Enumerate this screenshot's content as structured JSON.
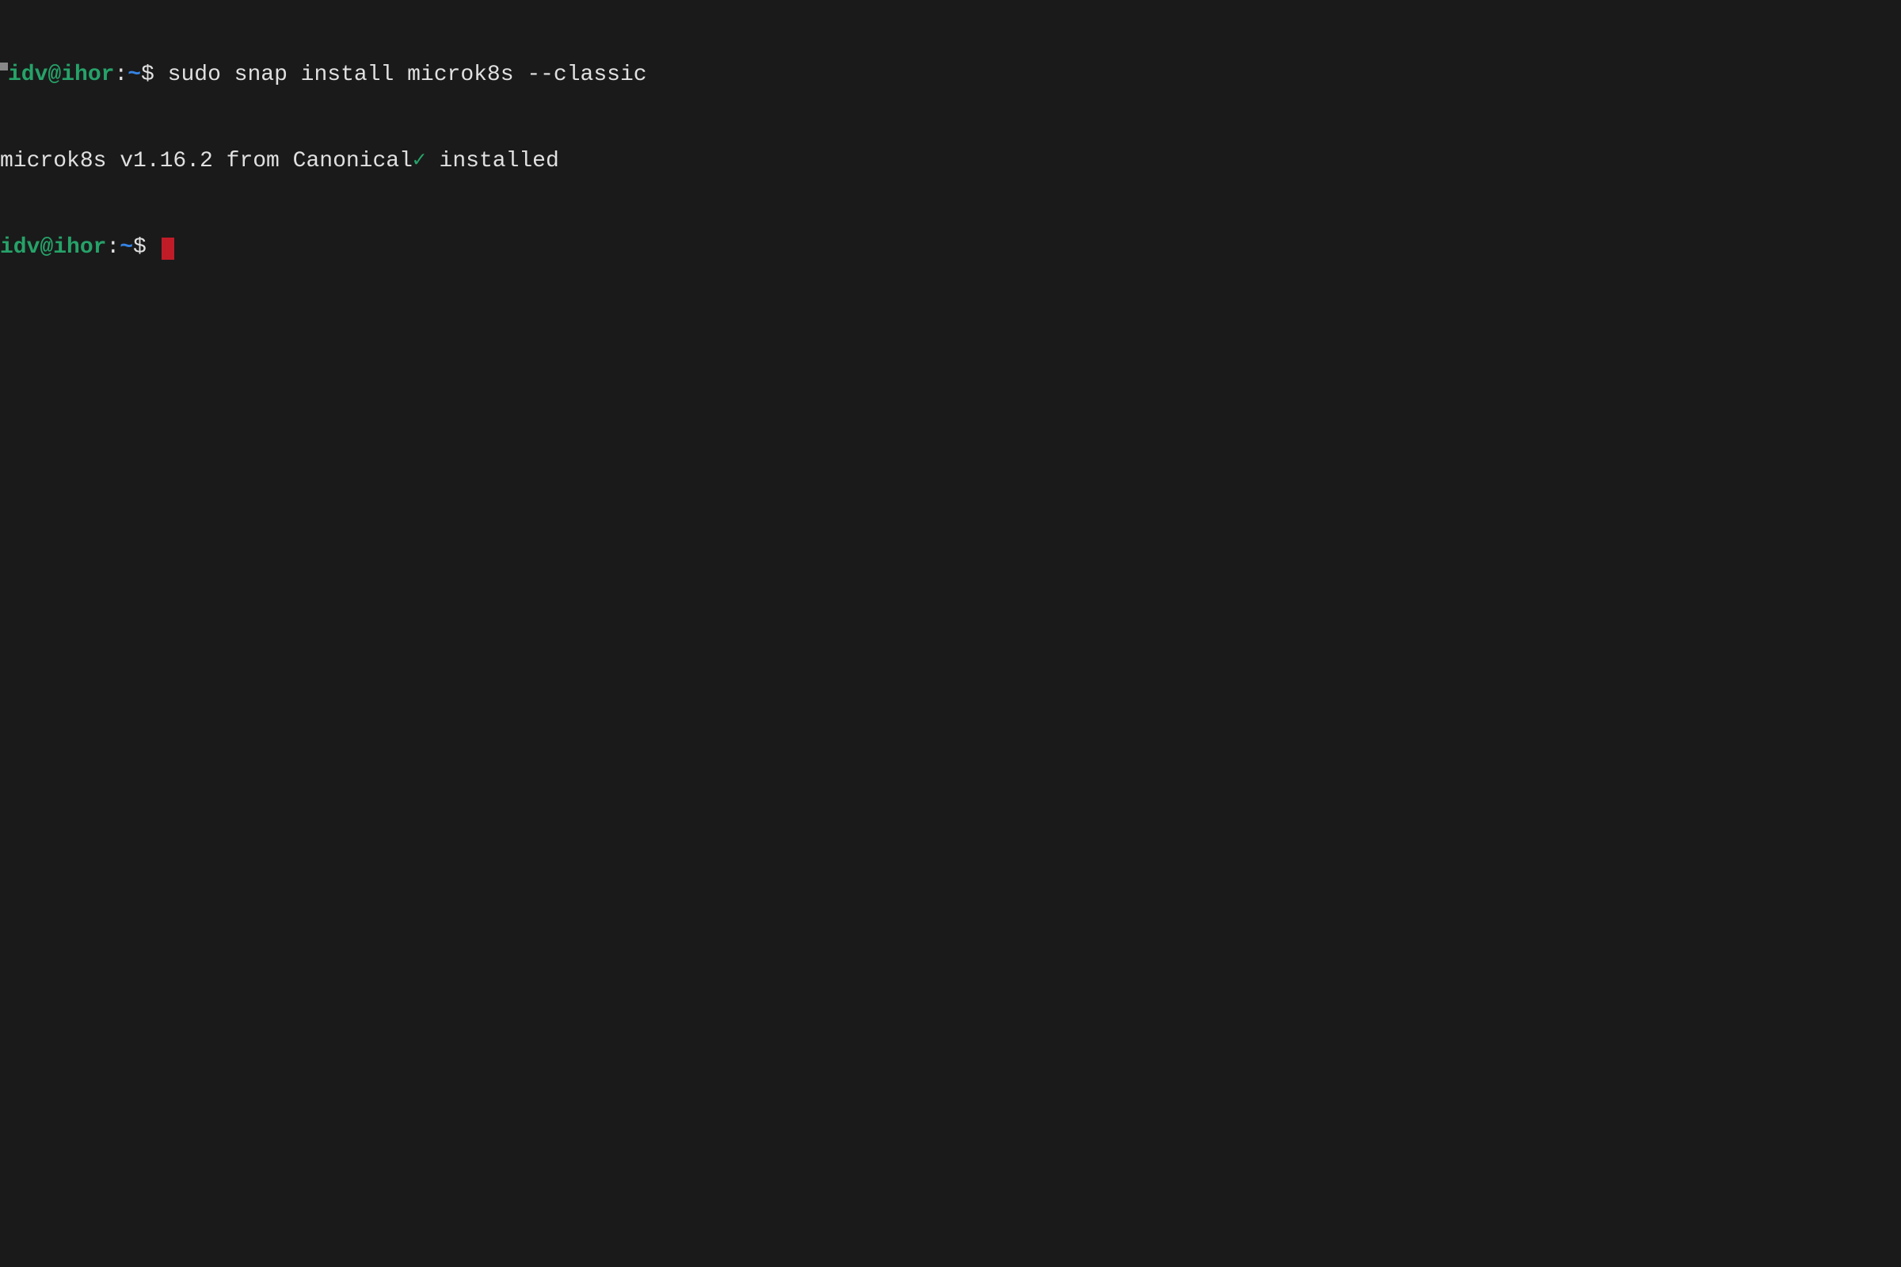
{
  "lines": [
    {
      "type": "prompt_with_command",
      "user_host": "idv@ihor",
      "colon": ":",
      "path": "~",
      "prompt_symbol": "$ ",
      "command": "sudo snap install microk8s --classic"
    },
    {
      "type": "output",
      "text_before": "microk8s v1.16.2 from Canonical",
      "checkmark": "✓",
      "text_after": " installed"
    },
    {
      "type": "prompt_empty",
      "user_host": "idv@ihor",
      "colon": ":",
      "path": "~",
      "prompt_symbol": "$ "
    }
  ]
}
